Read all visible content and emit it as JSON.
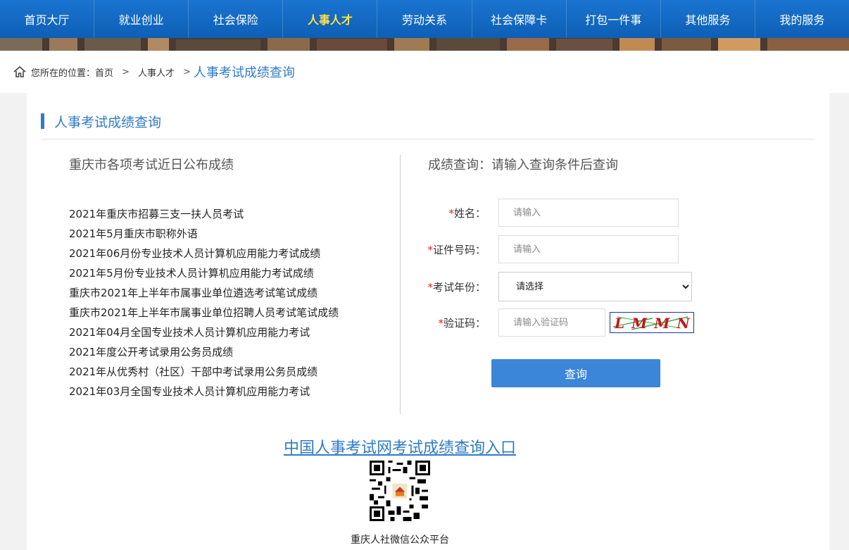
{
  "nav": {
    "items": [
      {
        "label": "首页大厅"
      },
      {
        "label": "就业创业"
      },
      {
        "label": "社会保险"
      },
      {
        "label": "人事人才"
      },
      {
        "label": "劳动关系"
      },
      {
        "label": "社会保障卡"
      },
      {
        "label": "打包一件事"
      },
      {
        "label": "其他服务"
      },
      {
        "label": "我的服务"
      }
    ],
    "active_label": "人事人才"
  },
  "breadcrumb": {
    "prefix": "您所在的位置：",
    "home": "首页",
    "sep": ">",
    "parent": "人事人才",
    "current": "人事考试成绩查询"
  },
  "panel": {
    "title": "人事考试成绩查询"
  },
  "recent": {
    "heading": "重庆市各项考试近日公布成绩",
    "items": [
      "2021年重庆市招募三支一扶人员考试",
      "2021年5月重庆市职称外语",
      "2021年06月份专业技术人员计算机应用能力考试成绩",
      "2021年5月份专业技术人员计算机应用能力考试成绩",
      "重庆市2021年上半年市属事业单位遴选考试笔试成绩",
      "重庆市2021年上半年市属事业单位招聘人员考试笔试成绩",
      "2021年04月全国专业技术人员计算机应用能力考试",
      "2021年度公开考试录用公务员成绩",
      "2021年从优秀村（社区）干部中考试录用公务员成绩",
      "2021年03月全国专业技术人员计算机应用能力考试"
    ]
  },
  "query": {
    "heading": "成绩查询：请输入查询条件后查询",
    "required_mark": "*",
    "name_label": "姓名：",
    "name_placeholder": "请输入",
    "id_label": "证件号码：",
    "id_placeholder": "请输入",
    "year_label": "考试年份：",
    "year_selected": "请选择",
    "captcha_label": "验证码：",
    "captcha_placeholder": "请输入验证码",
    "captcha_text": "LMMN",
    "button_label": "查询"
  },
  "footer": {
    "entry_link": "中国人事考试网考试成绩查询入口",
    "qr_caption": "重庆人社微信公众平台"
  },
  "colors": {
    "nav_bg": "#0e5fb5",
    "nav_active": "#ffe14a",
    "accent": "#2f7bc6",
    "button": "#3b86d8",
    "required": "#e02020"
  }
}
